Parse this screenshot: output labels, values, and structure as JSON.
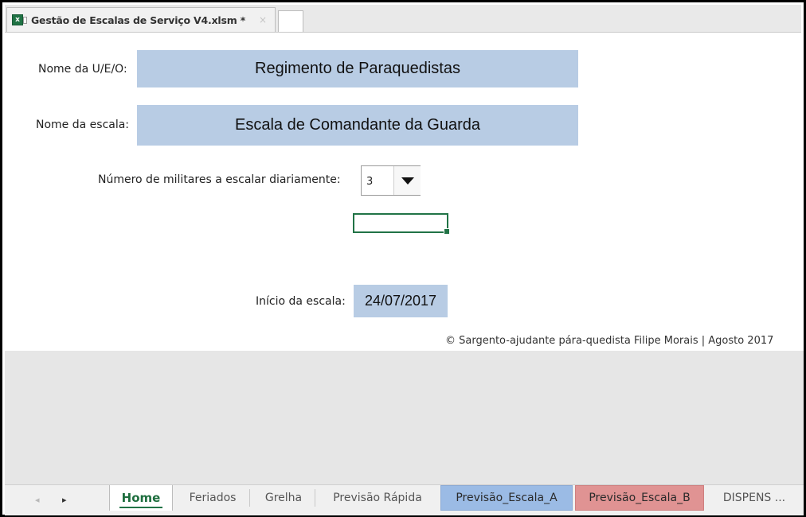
{
  "window": {
    "tab_title": "Gestão de Escalas de Serviço V4.xlsm *",
    "close_glyph": "×",
    "file_icon_letter": "x"
  },
  "form": {
    "unit_label": "Nome da U/E/O:",
    "unit_value": "Regimento de Paraquedistas",
    "scale_label": "Nome da escala:",
    "scale_value": "Escala de Comandante da Guarda",
    "count_label": "Número de militares a escalar diariamente:",
    "count_value": "3",
    "start_label": "Início da escala:",
    "start_value": "24/07/2017",
    "copyright": "© Sargento-ajudante pára-quedista Filipe Morais | Agosto 2017"
  },
  "sheet_tabs": {
    "prev_glyph": "◂",
    "next_glyph": "▸",
    "tabs": [
      "Home",
      "Feriados",
      "Grelha",
      "Previsão Rápida",
      "Previsão_Escala_A",
      "Previsão_Escala_B",
      "DISPENS ..."
    ]
  },
  "colors": {
    "input_fill": "#b8cce4",
    "excel_green": "#217346",
    "tab_blue": "#9bbbe5",
    "tab_red": "#e09393"
  },
  "icons": [
    "excel-file-icon",
    "close-icon",
    "dropdown-arrow-icon",
    "scroll-left-icon",
    "scroll-right-icon"
  ]
}
